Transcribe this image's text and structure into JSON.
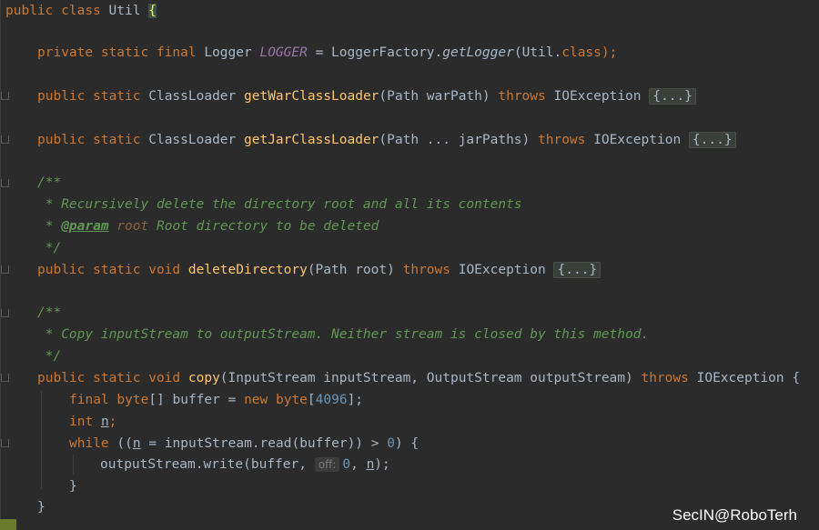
{
  "code": {
    "class_decl": {
      "public": "public",
      "class": "class",
      "name": "Util",
      "brace": "{"
    },
    "logger_line": {
      "mods": "private static final",
      "type": "Logger",
      "const": "LOGGER",
      "eq": " = LoggerFactory.",
      "method": "getLogger",
      "args": "(Util.",
      "class_kw": "class",
      "end": ");"
    },
    "method1": {
      "mods": "public static",
      "type": "ClassLoader",
      "name": "getWarClassLoader",
      "params": "(Path warPath)",
      "throws": "throws",
      "exc": "IOException",
      "fold": "{...}"
    },
    "method2": {
      "mods": "public static",
      "type": "ClassLoader",
      "name": "getJarClassLoader",
      "params": "(Path ... jarPaths)",
      "throws": "throws",
      "exc": "IOException",
      "fold": "{...}"
    },
    "doc1": {
      "open": "/**",
      "line1": " * Recursively delete the directory root and all its contents",
      "star": " * ",
      "tag": "@param",
      "param": "root",
      "desc": " Root directory to be deleted",
      "close": " */"
    },
    "method3": {
      "mods": "public static void",
      "name": "deleteDirectory",
      "params": "(Path root)",
      "throws": "throws",
      "exc": "IOException",
      "fold": "{...}"
    },
    "doc2": {
      "open": "/**",
      "line1": " * Copy inputStream to outputStream. Neither stream is closed by this method.",
      "close": " */"
    },
    "method4": {
      "mods": "public static void",
      "name": "copy",
      "params": "(InputStream inputStream, OutputStream outputStream)",
      "throws": "throws",
      "exc": "IOException {"
    },
    "body": {
      "l1_kw": "final byte",
      "l1_a": "[] buffer = ",
      "l1_new": "new byte",
      "l1_b": "[",
      "l1_num": "4096",
      "l1_c": "];",
      "l2_kw": "int",
      "l2_var": "n",
      "l2_end": ";",
      "l3_kw": "while",
      "l3_a": " ((",
      "l3_var": "n",
      "l3_b": " = inputStream.read(buffer)) > ",
      "l3_num": "0",
      "l3_c": ") {",
      "l4_a": "outputStream.write(buffer, ",
      "l4_hint": "off:",
      "l4_num": "0",
      "l4_b": ", ",
      "l4_var": "n",
      "l4_c": ");",
      "l5": "}",
      "l6": "}"
    }
  },
  "watermark": "SecIN@RoboTerh"
}
